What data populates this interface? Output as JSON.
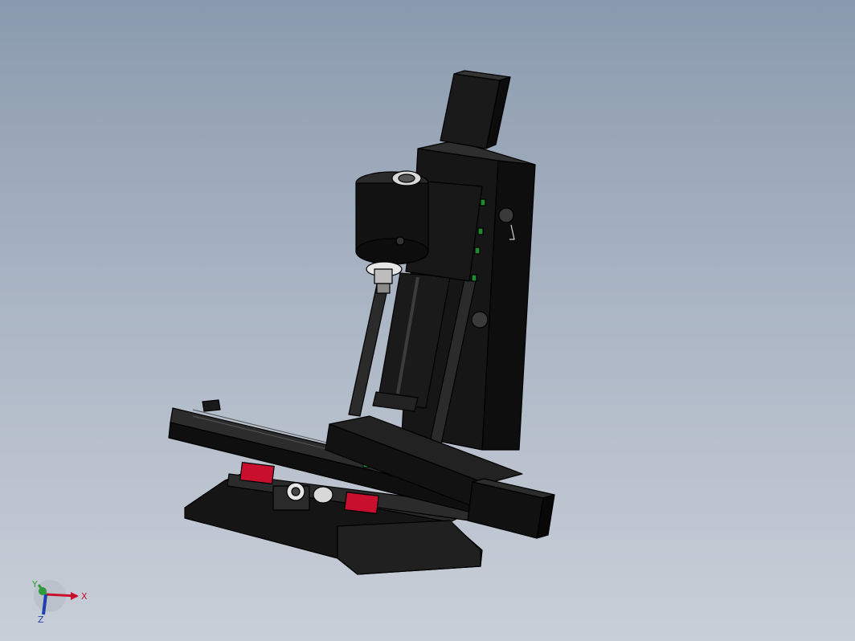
{
  "viewport": {
    "background_top": "#8a9aae",
    "background_bottom": "#c9cfd8",
    "model": {
      "body_color": "#1d1d1d",
      "edge_color": "#000000",
      "rail_block_color": "#c8102e",
      "slider_color": "#1f8a2e",
      "spindle_nose_color": "#e6e6e6"
    }
  },
  "triad": {
    "x_label": "X",
    "y_label": "Y",
    "z_label": "Z",
    "x_color": "#c8102e",
    "y_color": "#2e9a3a",
    "z_color": "#1f3fb0"
  }
}
